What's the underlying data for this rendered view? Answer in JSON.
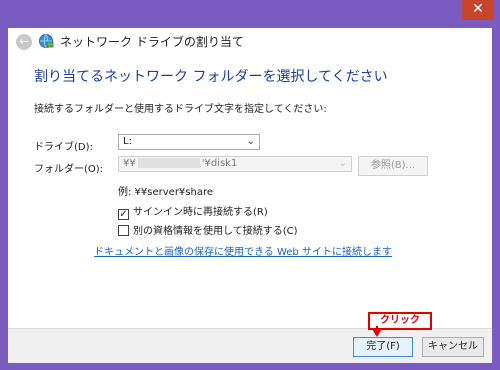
{
  "window": {
    "close_glyph": "✕",
    "title": "ネットワーク ドライブの割り当て",
    "back_icon": "back-arrow-icon",
    "network_icon": "network-drive-icon"
  },
  "main": {
    "heading": "割り当てるネットワーク フォルダーを選択してください",
    "instruction": "接続するフォルダーと使用するドライブ文字を指定してください:",
    "drive_label": "ドライブ(D):",
    "drive_value": "L:",
    "folder_label": "フォルダー(O):",
    "folder_value_prefix": "¥¥",
    "folder_value_suffix": "'¥disk1",
    "browse_label": "参照(B)...",
    "example": "例: ¥¥server¥share",
    "reconnect_label": "サインイン時に再接続する(R)",
    "reconnect_checked": true,
    "other_creds_label": "別の資格情報を使用して接続する(C)",
    "other_creds_checked": false,
    "link_text": "ドキュメントと画像の保存に使用できる Web サイトに接続します"
  },
  "footer": {
    "finish_label": "完了(F)",
    "cancel_label": "キャンセル"
  },
  "annotation": {
    "callout_text": "クリック",
    "color": "#e00000"
  }
}
